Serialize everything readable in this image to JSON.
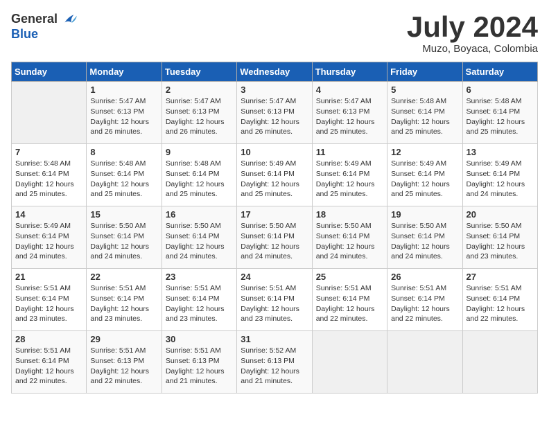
{
  "header": {
    "logo_general": "General",
    "logo_blue": "Blue",
    "month_year": "July 2024",
    "location": "Muzo, Boyaca, Colombia"
  },
  "days_of_week": [
    "Sunday",
    "Monday",
    "Tuesday",
    "Wednesday",
    "Thursday",
    "Friday",
    "Saturday"
  ],
  "weeks": [
    [
      {
        "day": "",
        "info": ""
      },
      {
        "day": "1",
        "info": "Sunrise: 5:47 AM\nSunset: 6:13 PM\nDaylight: 12 hours\nand 26 minutes."
      },
      {
        "day": "2",
        "info": "Sunrise: 5:47 AM\nSunset: 6:13 PM\nDaylight: 12 hours\nand 26 minutes."
      },
      {
        "day": "3",
        "info": "Sunrise: 5:47 AM\nSunset: 6:13 PM\nDaylight: 12 hours\nand 26 minutes."
      },
      {
        "day": "4",
        "info": "Sunrise: 5:47 AM\nSunset: 6:13 PM\nDaylight: 12 hours\nand 25 minutes."
      },
      {
        "day": "5",
        "info": "Sunrise: 5:48 AM\nSunset: 6:14 PM\nDaylight: 12 hours\nand 25 minutes."
      },
      {
        "day": "6",
        "info": "Sunrise: 5:48 AM\nSunset: 6:14 PM\nDaylight: 12 hours\nand 25 minutes."
      }
    ],
    [
      {
        "day": "7",
        "info": "Sunrise: 5:48 AM\nSunset: 6:14 PM\nDaylight: 12 hours\nand 25 minutes."
      },
      {
        "day": "8",
        "info": "Sunrise: 5:48 AM\nSunset: 6:14 PM\nDaylight: 12 hours\nand 25 minutes."
      },
      {
        "day": "9",
        "info": "Sunrise: 5:48 AM\nSunset: 6:14 PM\nDaylight: 12 hours\nand 25 minutes."
      },
      {
        "day": "10",
        "info": "Sunrise: 5:49 AM\nSunset: 6:14 PM\nDaylight: 12 hours\nand 25 minutes."
      },
      {
        "day": "11",
        "info": "Sunrise: 5:49 AM\nSunset: 6:14 PM\nDaylight: 12 hours\nand 25 minutes."
      },
      {
        "day": "12",
        "info": "Sunrise: 5:49 AM\nSunset: 6:14 PM\nDaylight: 12 hours\nand 25 minutes."
      },
      {
        "day": "13",
        "info": "Sunrise: 5:49 AM\nSunset: 6:14 PM\nDaylight: 12 hours\nand 24 minutes."
      }
    ],
    [
      {
        "day": "14",
        "info": "Sunrise: 5:49 AM\nSunset: 6:14 PM\nDaylight: 12 hours\nand 24 minutes."
      },
      {
        "day": "15",
        "info": "Sunrise: 5:50 AM\nSunset: 6:14 PM\nDaylight: 12 hours\nand 24 minutes."
      },
      {
        "day": "16",
        "info": "Sunrise: 5:50 AM\nSunset: 6:14 PM\nDaylight: 12 hours\nand 24 minutes."
      },
      {
        "day": "17",
        "info": "Sunrise: 5:50 AM\nSunset: 6:14 PM\nDaylight: 12 hours\nand 24 minutes."
      },
      {
        "day": "18",
        "info": "Sunrise: 5:50 AM\nSunset: 6:14 PM\nDaylight: 12 hours\nand 24 minutes."
      },
      {
        "day": "19",
        "info": "Sunrise: 5:50 AM\nSunset: 6:14 PM\nDaylight: 12 hours\nand 24 minutes."
      },
      {
        "day": "20",
        "info": "Sunrise: 5:50 AM\nSunset: 6:14 PM\nDaylight: 12 hours\nand 23 minutes."
      }
    ],
    [
      {
        "day": "21",
        "info": "Sunrise: 5:51 AM\nSunset: 6:14 PM\nDaylight: 12 hours\nand 23 minutes."
      },
      {
        "day": "22",
        "info": "Sunrise: 5:51 AM\nSunset: 6:14 PM\nDaylight: 12 hours\nand 23 minutes."
      },
      {
        "day": "23",
        "info": "Sunrise: 5:51 AM\nSunset: 6:14 PM\nDaylight: 12 hours\nand 23 minutes."
      },
      {
        "day": "24",
        "info": "Sunrise: 5:51 AM\nSunset: 6:14 PM\nDaylight: 12 hours\nand 23 minutes."
      },
      {
        "day": "25",
        "info": "Sunrise: 5:51 AM\nSunset: 6:14 PM\nDaylight: 12 hours\nand 22 minutes."
      },
      {
        "day": "26",
        "info": "Sunrise: 5:51 AM\nSunset: 6:14 PM\nDaylight: 12 hours\nand 22 minutes."
      },
      {
        "day": "27",
        "info": "Sunrise: 5:51 AM\nSunset: 6:14 PM\nDaylight: 12 hours\nand 22 minutes."
      }
    ],
    [
      {
        "day": "28",
        "info": "Sunrise: 5:51 AM\nSunset: 6:14 PM\nDaylight: 12 hours\nand 22 minutes."
      },
      {
        "day": "29",
        "info": "Sunrise: 5:51 AM\nSunset: 6:13 PM\nDaylight: 12 hours\nand 22 minutes."
      },
      {
        "day": "30",
        "info": "Sunrise: 5:51 AM\nSunset: 6:13 PM\nDaylight: 12 hours\nand 21 minutes."
      },
      {
        "day": "31",
        "info": "Sunrise: 5:52 AM\nSunset: 6:13 PM\nDaylight: 12 hours\nand 21 minutes."
      },
      {
        "day": "",
        "info": ""
      },
      {
        "day": "",
        "info": ""
      },
      {
        "day": "",
        "info": ""
      }
    ]
  ]
}
